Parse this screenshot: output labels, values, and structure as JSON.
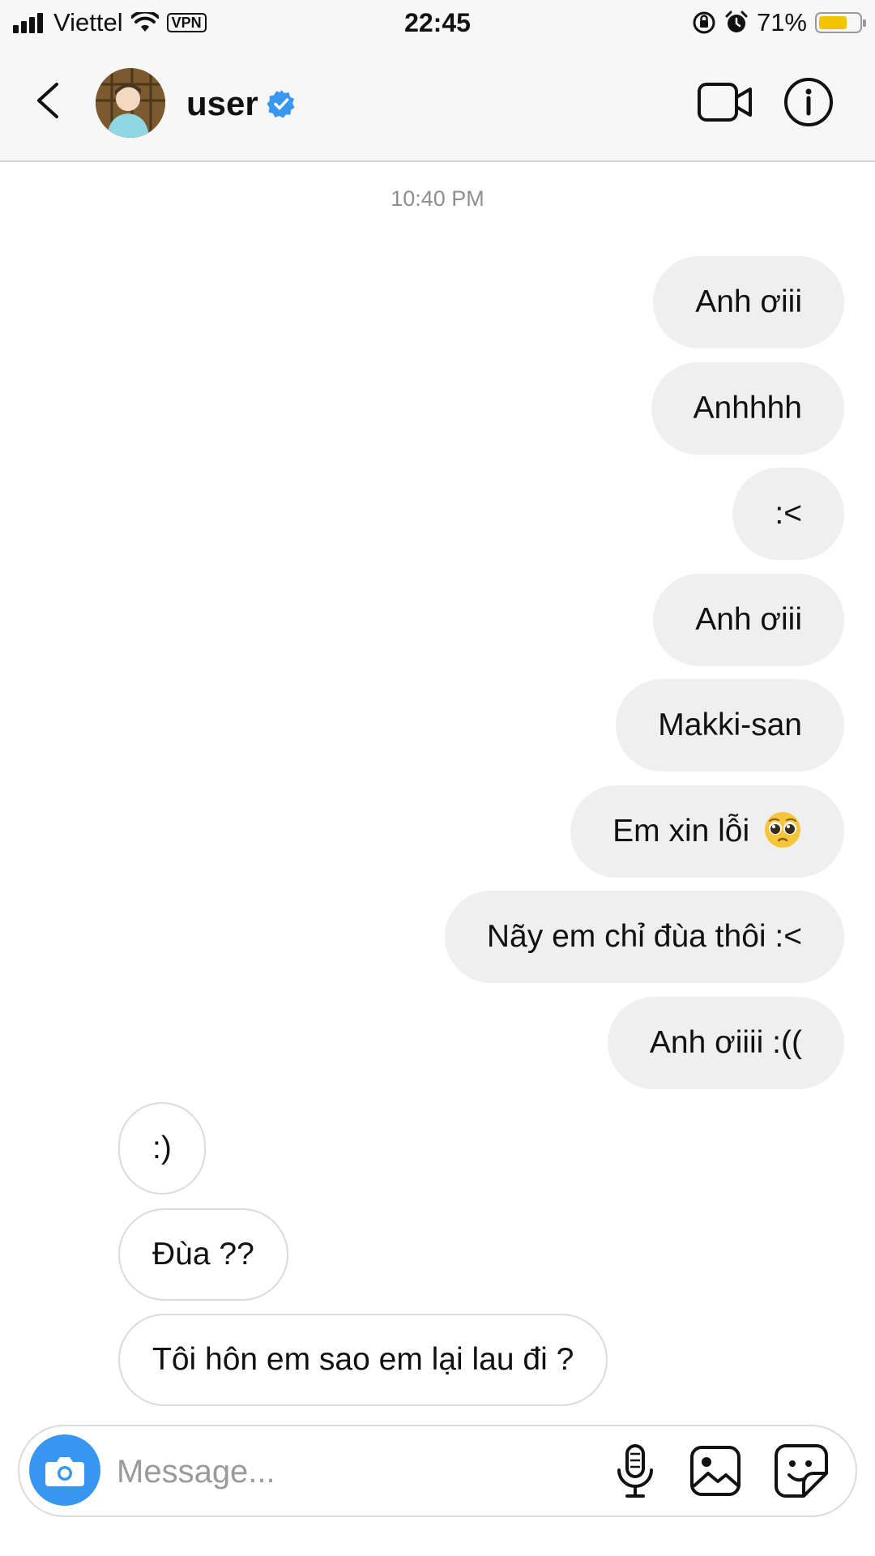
{
  "status_bar": {
    "carrier": "Viettel",
    "vpn_label": "VPN",
    "time": "22:45",
    "battery_percent": "71%",
    "battery_level": 0.71,
    "battery_color": "#f5c400"
  },
  "header": {
    "username": "user",
    "verified": true,
    "icons": [
      "chevron-left-icon",
      "verified-badge-icon",
      "video-camera-icon",
      "info-icon"
    ]
  },
  "conversation": {
    "timestamp": "10:40 PM",
    "outgoing": [
      "Anh ơiii",
      "Anhhhh",
      ":<",
      "Anh ơiii",
      "Makki-san",
      "Em xin lỗi",
      "Nãy em chỉ đùa thôi :<",
      "Anh ơiiii :(("
    ],
    "outgoing_emoji": "pleading-face-emoji",
    "incoming": [
      ":)",
      "Đùa ??",
      "Tôi hôn em sao em lại lau đi ?"
    ]
  },
  "composer": {
    "placeholder": "Message...",
    "value": "",
    "icons": [
      "camera-icon",
      "microphone-icon",
      "image-gallery-icon",
      "sticker-icon"
    ],
    "camera_color": "#3797f0"
  },
  "colors": {
    "outgoing_bubble": "#efefef",
    "incoming_border": "#dbdbdb",
    "verified_blue": "#3897f0",
    "muted_text": "#8e8e8e"
  }
}
